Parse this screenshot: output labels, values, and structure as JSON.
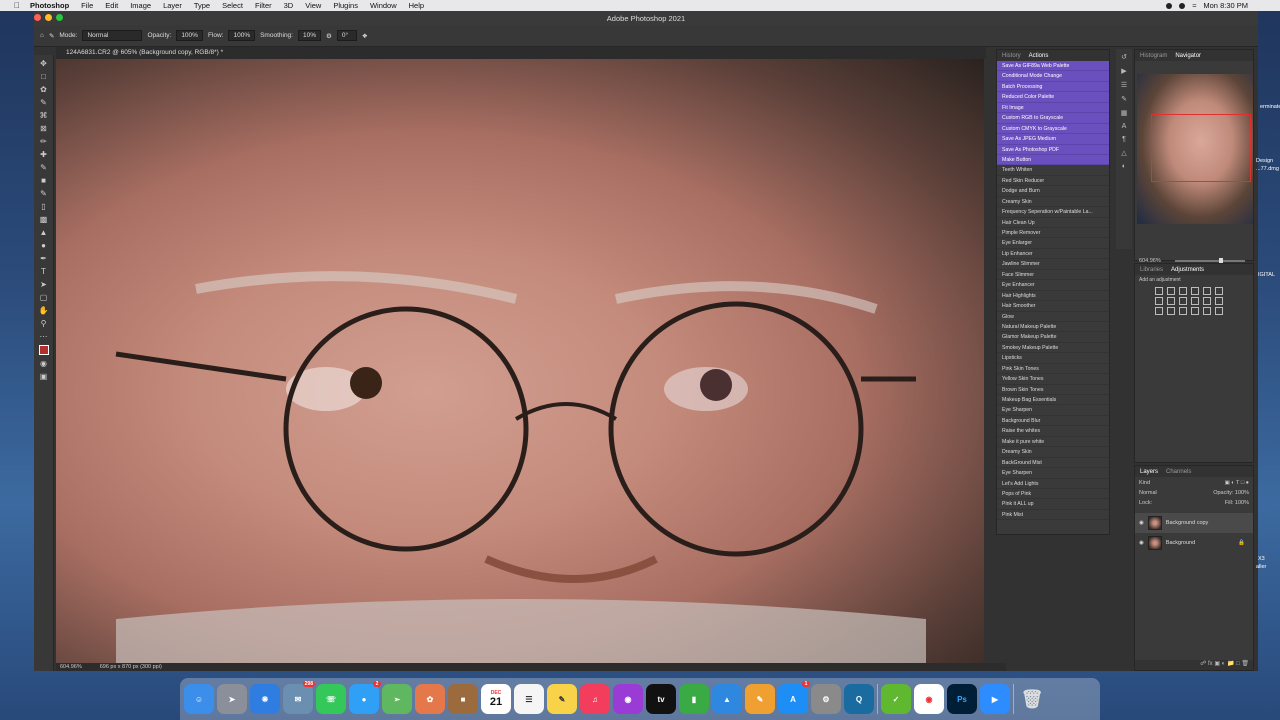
{
  "menubar": {
    "app_name": "Photoshop",
    "items": [
      "File",
      "Edit",
      "Image",
      "Layer",
      "Type",
      "Select",
      "Filter",
      "3D",
      "View",
      "Plugins",
      "Window",
      "Help"
    ],
    "clock": "Mon 8:30 PM"
  },
  "window": {
    "title": "Adobe Photoshop 2021",
    "doc_tab": "124A6831.CR2 @ 605% (Background copy, RGB/8*) *"
  },
  "options_bar": {
    "mode_label": "Mode:",
    "mode_value": "Normal",
    "opacity_label": "Opacity:",
    "opacity_value": "100%",
    "flow_label": "Flow:",
    "flow_value": "100%",
    "smoothing_label": "Smoothing:",
    "smoothing_value": "10%",
    "angle_value": "0°"
  },
  "status": {
    "zoom": "604.96%",
    "doc_size": "696 px x 870 px (300 ppi)"
  },
  "actions_panel": {
    "tabs": [
      "History",
      "Actions"
    ],
    "items": [
      {
        "label": "Save As GIF89a Web Palette",
        "selected": true
      },
      {
        "label": "Conditional Mode Change",
        "selected": true
      },
      {
        "label": "Batch Processing",
        "selected": true
      },
      {
        "label": "Reduced Color Palette",
        "selected": true
      },
      {
        "label": "Fit Image",
        "selected": true
      },
      {
        "label": "Custom RGB to Grayscale",
        "selected": true
      },
      {
        "label": "Custom CMYK to Grayscale",
        "selected": true
      },
      {
        "label": "Save As JPEG Medium",
        "selected": true
      },
      {
        "label": "Save As Photoshop PDF",
        "selected": true
      },
      {
        "label": "Make Button",
        "selected": true
      },
      {
        "label": "Teeth Whiten",
        "selected": false
      },
      {
        "label": "Red Skin Reducer",
        "selected": false
      },
      {
        "label": "Dodge and Burn",
        "selected": false
      },
      {
        "label": "Creamy Skin",
        "selected": false
      },
      {
        "label": "Frequency Seperation w/Paintable La...",
        "selected": false
      },
      {
        "label": "Hair Clean Up",
        "selected": false
      },
      {
        "label": "Pimple Remover",
        "selected": false
      },
      {
        "label": "Eye Enlarger",
        "selected": false
      },
      {
        "label": "Lip Enhancer",
        "selected": false
      },
      {
        "label": "Jawline Slimmer",
        "selected": false
      },
      {
        "label": "Face Slimmer",
        "selected": false
      },
      {
        "label": "Eye Enhancer",
        "selected": false
      },
      {
        "label": "Hair Highlights",
        "selected": false
      },
      {
        "label": "Hair Smoother",
        "selected": false
      },
      {
        "label": "Glow",
        "selected": false
      },
      {
        "label": "Natural Makeup Palette",
        "selected": false
      },
      {
        "label": "Glamor Makeup Palette",
        "selected": false
      },
      {
        "label": "Smokey Makeup Palette",
        "selected": false
      },
      {
        "label": "Lipsticks",
        "selected": false
      },
      {
        "label": "Pink Skin Tones",
        "selected": false
      },
      {
        "label": "Yellow Skin Tones",
        "selected": false
      },
      {
        "label": "Brown Skin Tones",
        "selected": false
      },
      {
        "label": "Makeup Bag Essentials",
        "selected": false
      },
      {
        "label": "Eye Sharpen",
        "selected": false
      },
      {
        "label": "Background Blur",
        "selected": false
      },
      {
        "label": "Raise the whites",
        "selected": false
      },
      {
        "label": "Make it pure white",
        "selected": false
      },
      {
        "label": "Dreamy Skin",
        "selected": false
      },
      {
        "label": "BackGround Mist",
        "selected": false
      },
      {
        "label": "Eye Sharpen",
        "selected": false
      },
      {
        "label": "Let's Add Lights",
        "selected": false
      },
      {
        "label": "Pops of Pink",
        "selected": false
      },
      {
        "label": "Pink it ALL up",
        "selected": false
      },
      {
        "label": "Pink Mist",
        "selected": false
      }
    ],
    "selected_color": "#6a4fbf"
  },
  "navigator": {
    "tabs": [
      "Histogram",
      "Navigator"
    ],
    "zoom": "604.96%"
  },
  "adjustments": {
    "tabs": [
      "Libraries",
      "Adjustments"
    ],
    "hint": "Add an adjustment"
  },
  "layers": {
    "tabs": [
      "Layers",
      "Channels"
    ],
    "kind_label": "Kind",
    "blend_mode": "Normal",
    "opacity_label": "Opacity:",
    "opacity_value": "100%",
    "lock_label": "Lock:",
    "fill_label": "Fill:",
    "fill_value": "100%",
    "items": [
      {
        "name": "Background copy",
        "active": true
      },
      {
        "name": "Background",
        "active": false
      }
    ]
  },
  "dock": {
    "mail_badge": "298",
    "messages_badge": "2",
    "calendar_month": "DEC",
    "calendar_day": "21",
    "appstore_badge": "1",
    "photoshop_label": "Ps"
  },
  "desktop_labels": [
    "erminate",
    "Design",
    "...77.dmg",
    "IGITAL",
    "X3",
    "aller"
  ]
}
